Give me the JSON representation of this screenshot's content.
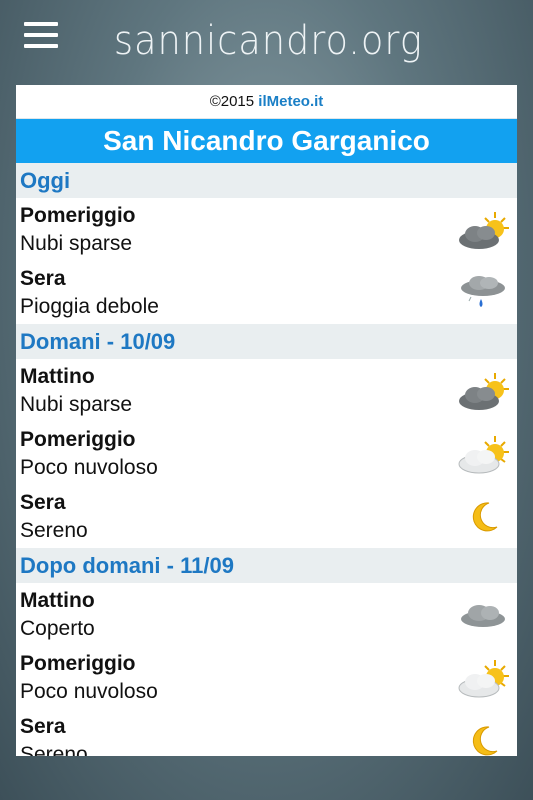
{
  "header": {
    "title": "sannicandro.org"
  },
  "widget": {
    "copyright_prefix": "©2015 ",
    "copyright_brand": "ilMeteo.it",
    "city": "San Nicandro Garganico",
    "sections": [
      {
        "title": "Oggi",
        "rows": [
          {
            "period": "Pomeriggio",
            "desc": "Nubi sparse",
            "icon": "scattered-clouds-icon"
          },
          {
            "period": "Sera",
            "desc": "Pioggia debole",
            "icon": "light-rain-icon"
          }
        ]
      },
      {
        "title": "Domani - 10/09",
        "rows": [
          {
            "period": "Mattino",
            "desc": "Nubi sparse",
            "icon": "scattered-clouds-icon"
          },
          {
            "period": "Pomeriggio",
            "desc": "Poco nuvoloso",
            "icon": "partly-cloudy-icon"
          },
          {
            "period": "Sera",
            "desc": "Sereno",
            "icon": "clear-night-moon-icon"
          }
        ]
      },
      {
        "title": "Dopo domani - 11/09",
        "rows": [
          {
            "period": "Mattino",
            "desc": "Coperto",
            "icon": "overcast-icon"
          },
          {
            "period": "Pomeriggio",
            "desc": "Poco nuvoloso",
            "icon": "partly-cloudy-icon"
          },
          {
            "period": "Sera",
            "desc": "Sereno",
            "icon": "clear-night-moon-icon"
          }
        ]
      }
    ]
  },
  "colors": {
    "city_bar": "#12a1f0",
    "section_text": "#1e78c3",
    "section_bg": "#e9eef0",
    "brand_link": "#1a7fc6"
  }
}
